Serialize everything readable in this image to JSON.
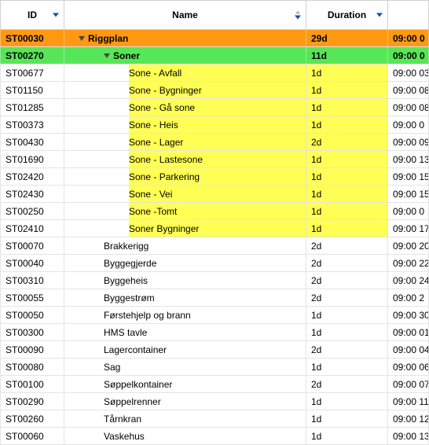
{
  "columns": {
    "id": "ID",
    "name": "Name",
    "duration": "Duration",
    "extra": ""
  },
  "rows": [
    {
      "id": "ST00030",
      "name": "Riggplan",
      "duration": "29d",
      "ext": "09:00 0",
      "level": 0,
      "kind": "orange",
      "expander": true,
      "hl": false
    },
    {
      "id": "ST00270",
      "name": "Soner",
      "duration": "11d",
      "ext": "09:00 0",
      "level": 1,
      "kind": "green",
      "expander": true,
      "hl": false
    },
    {
      "id": "ST00677",
      "name": "Sone - Avfall",
      "duration": "1d",
      "ext": "09:00 03",
      "level": 2,
      "kind": "plain",
      "expander": false,
      "hl": true
    },
    {
      "id": "ST01150",
      "name": "Sone - Bygninger",
      "duration": "1d",
      "ext": "09:00 08",
      "level": 2,
      "kind": "plain",
      "expander": false,
      "hl": true
    },
    {
      "id": "ST01285",
      "name": "Sone - Gå sone",
      "duration": "1d",
      "ext": "09:00 08",
      "level": 2,
      "kind": "plain",
      "expander": false,
      "hl": true
    },
    {
      "id": "ST00373",
      "name": "Sone - Heis",
      "duration": "1d",
      "ext": "09:00 0",
      "level": 2,
      "kind": "plain",
      "expander": false,
      "hl": true
    },
    {
      "id": "ST00430",
      "name": "Sone - Lager",
      "duration": "2d",
      "ext": "09:00 09",
      "level": 2,
      "kind": "plain",
      "expander": false,
      "hl": true
    },
    {
      "id": "ST01690",
      "name": "Sone - Lastesone",
      "duration": "1d",
      "ext": "09:00 13",
      "level": 2,
      "kind": "plain",
      "expander": false,
      "hl": true
    },
    {
      "id": "ST02420",
      "name": "Sone - Parkering",
      "duration": "1d",
      "ext": "09:00 15",
      "level": 2,
      "kind": "plain",
      "expander": false,
      "hl": true
    },
    {
      "id": "ST02430",
      "name": "Sone - Vei",
      "duration": "1d",
      "ext": "09:00 15",
      "level": 2,
      "kind": "plain",
      "expander": false,
      "hl": true
    },
    {
      "id": "ST00250",
      "name": "Sone -Tomt",
      "duration": "1d",
      "ext": "09:00 0",
      "level": 2,
      "kind": "plain",
      "expander": false,
      "hl": true
    },
    {
      "id": "ST02410",
      "name": "Soner Bygninger",
      "duration": "1d",
      "ext": "09:00 17",
      "level": 2,
      "kind": "plain",
      "expander": false,
      "hl": true
    },
    {
      "id": "ST00070",
      "name": "Brakkerigg",
      "duration": "2d",
      "ext": "09:00 20",
      "level": 1,
      "kind": "plain",
      "expander": false,
      "hl": false
    },
    {
      "id": "ST00040",
      "name": "Byggegjerde",
      "duration": "2d",
      "ext": "09:00 22",
      "level": 1,
      "kind": "plain",
      "expander": false,
      "hl": false
    },
    {
      "id": "ST00310",
      "name": "Byggeheis",
      "duration": "2d",
      "ext": "09:00 24",
      "level": 1,
      "kind": "plain",
      "expander": false,
      "hl": false
    },
    {
      "id": "ST00055",
      "name": "Byggestrøm",
      "duration": "2d",
      "ext": "09:00 2",
      "level": 1,
      "kind": "plain",
      "expander": false,
      "hl": false
    },
    {
      "id": "ST00050",
      "name": "Førstehjelp og brann",
      "duration": "1d",
      "ext": "09:00 30",
      "level": 1,
      "kind": "plain",
      "expander": false,
      "hl": false
    },
    {
      "id": "ST00300",
      "name": "HMS tavle",
      "duration": "1d",
      "ext": "09:00 01",
      "level": 1,
      "kind": "plain",
      "expander": false,
      "hl": false
    },
    {
      "id": "ST00090",
      "name": "Lagercontainer",
      "duration": "2d",
      "ext": "09:00 04",
      "level": 1,
      "kind": "plain",
      "expander": false,
      "hl": false
    },
    {
      "id": "ST00080",
      "name": "Sag",
      "duration": "1d",
      "ext": "09:00 06",
      "level": 1,
      "kind": "plain",
      "expander": false,
      "hl": false
    },
    {
      "id": "ST00100",
      "name": "Søppelkontainer",
      "duration": "2d",
      "ext": "09:00 07",
      "level": 1,
      "kind": "plain",
      "expander": false,
      "hl": false
    },
    {
      "id": "ST00290",
      "name": "Søppelrenner",
      "duration": "1d",
      "ext": "09:00 11",
      "level": 1,
      "kind": "plain",
      "expander": false,
      "hl": false
    },
    {
      "id": "ST00260",
      "name": "Tårnkran",
      "duration": "1d",
      "ext": "09:00 12",
      "level": 1,
      "kind": "plain",
      "expander": false,
      "hl": false
    },
    {
      "id": "ST00060",
      "name": "Vaskehus",
      "duration": "1d",
      "ext": "09:00 13",
      "level": 1,
      "kind": "plain",
      "expander": false,
      "hl": false
    }
  ],
  "indents": {
    "0": 18,
    "1": 50,
    "2": 82
  }
}
